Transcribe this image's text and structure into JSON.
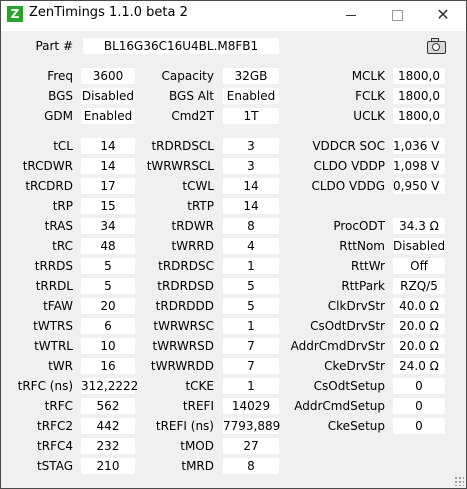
{
  "window": {
    "title": "ZenTimings 1.1.0 beta 2",
    "icon_letter": "Z",
    "maximize_glyph": "",
    "close_glyph": "✕"
  },
  "part": {
    "label": "Part #",
    "value": "BL16G36C16U4BL.M8FB1"
  },
  "info": [
    {
      "label": "Freq",
      "value": "3600"
    },
    {
      "label": "Capacity",
      "value": "32GB"
    },
    {
      "label": "MCLK",
      "value": "1800,0"
    },
    {
      "label": "BGS",
      "value": "Disabled"
    },
    {
      "label": "BGS Alt",
      "value": "Enabled"
    },
    {
      "label": "FCLK",
      "value": "1800,0"
    },
    {
      "label": "GDM",
      "value": "Enabled"
    },
    {
      "label": "Cmd2T",
      "value": "1T"
    },
    {
      "label": "UCLK",
      "value": "1800,0"
    }
  ],
  "col1": [
    {
      "label": "tCL",
      "value": "14"
    },
    {
      "label": "tRCDWR",
      "value": "14"
    },
    {
      "label": "tRCDRD",
      "value": "17"
    },
    {
      "label": "tRP",
      "value": "15"
    },
    {
      "label": "tRAS",
      "value": "34"
    },
    {
      "label": "tRC",
      "value": "48"
    },
    {
      "label": "tRRDS",
      "value": "5"
    },
    {
      "label": "tRRDL",
      "value": "5"
    },
    {
      "label": "tFAW",
      "value": "20"
    },
    {
      "label": "tWTRS",
      "value": "6"
    },
    {
      "label": "tWTRL",
      "value": "10"
    },
    {
      "label": "tWR",
      "value": "16"
    },
    {
      "label": "tRFC (ns)",
      "value": "312,2222"
    },
    {
      "label": "tRFC",
      "value": "562"
    },
    {
      "label": "tRFC2",
      "value": "442"
    },
    {
      "label": "tRFC4",
      "value": "232"
    },
    {
      "label": "tSTAG",
      "value": "210"
    }
  ],
  "col2": [
    {
      "label": "tRDRDSCL",
      "value": "3"
    },
    {
      "label": "tWRWRSCL",
      "value": "3"
    },
    {
      "label": "tCWL",
      "value": "14"
    },
    {
      "label": "tRTP",
      "value": "14"
    },
    {
      "label": "tRDWR",
      "value": "8"
    },
    {
      "label": "tWRRD",
      "value": "4"
    },
    {
      "label": "tRDRDSC",
      "value": "1"
    },
    {
      "label": "tRDRDSD",
      "value": "5"
    },
    {
      "label": "tRDRDDD",
      "value": "5"
    },
    {
      "label": "tWRWRSC",
      "value": "1"
    },
    {
      "label": "tWRWRSD",
      "value": "7"
    },
    {
      "label": "tWRWRDD",
      "value": "7"
    },
    {
      "label": "tCKE",
      "value": "1"
    },
    {
      "label": "tREFI",
      "value": "14029"
    },
    {
      "label": "tREFI (ns)",
      "value": "7793,889"
    },
    {
      "label": "tMOD",
      "value": "27"
    },
    {
      "label": "tMRD",
      "value": "8"
    }
  ],
  "voltages": [
    {
      "label": "VDDCR SOC",
      "value": "1,036 V"
    },
    {
      "label": "CLDO VDDP",
      "value": "1,098 V"
    },
    {
      "label": "CLDO VDDG",
      "value": "0,950 V"
    }
  ],
  "col3": [
    {
      "label": "ProcODT",
      "value": "34.3 Ω"
    },
    {
      "label": "RttNom",
      "value": "Disabled"
    },
    {
      "label": "RttWr",
      "value": "Off"
    },
    {
      "label": "RttPark",
      "value": "RZQ/5"
    },
    {
      "label": "ClkDrvStr",
      "value": "40.0 Ω"
    },
    {
      "label": "CsOdtDrvStr",
      "value": "20.0 Ω"
    },
    {
      "label": "AddrCmdDrvStr",
      "value": "20.0 Ω"
    },
    {
      "label": "CkeDrvStr",
      "value": "24.0 Ω"
    },
    {
      "label": "CsOdtSetup",
      "value": "0"
    },
    {
      "label": "AddrCmdSetup",
      "value": "0"
    },
    {
      "label": "CkeSetup",
      "value": "0"
    }
  ]
}
